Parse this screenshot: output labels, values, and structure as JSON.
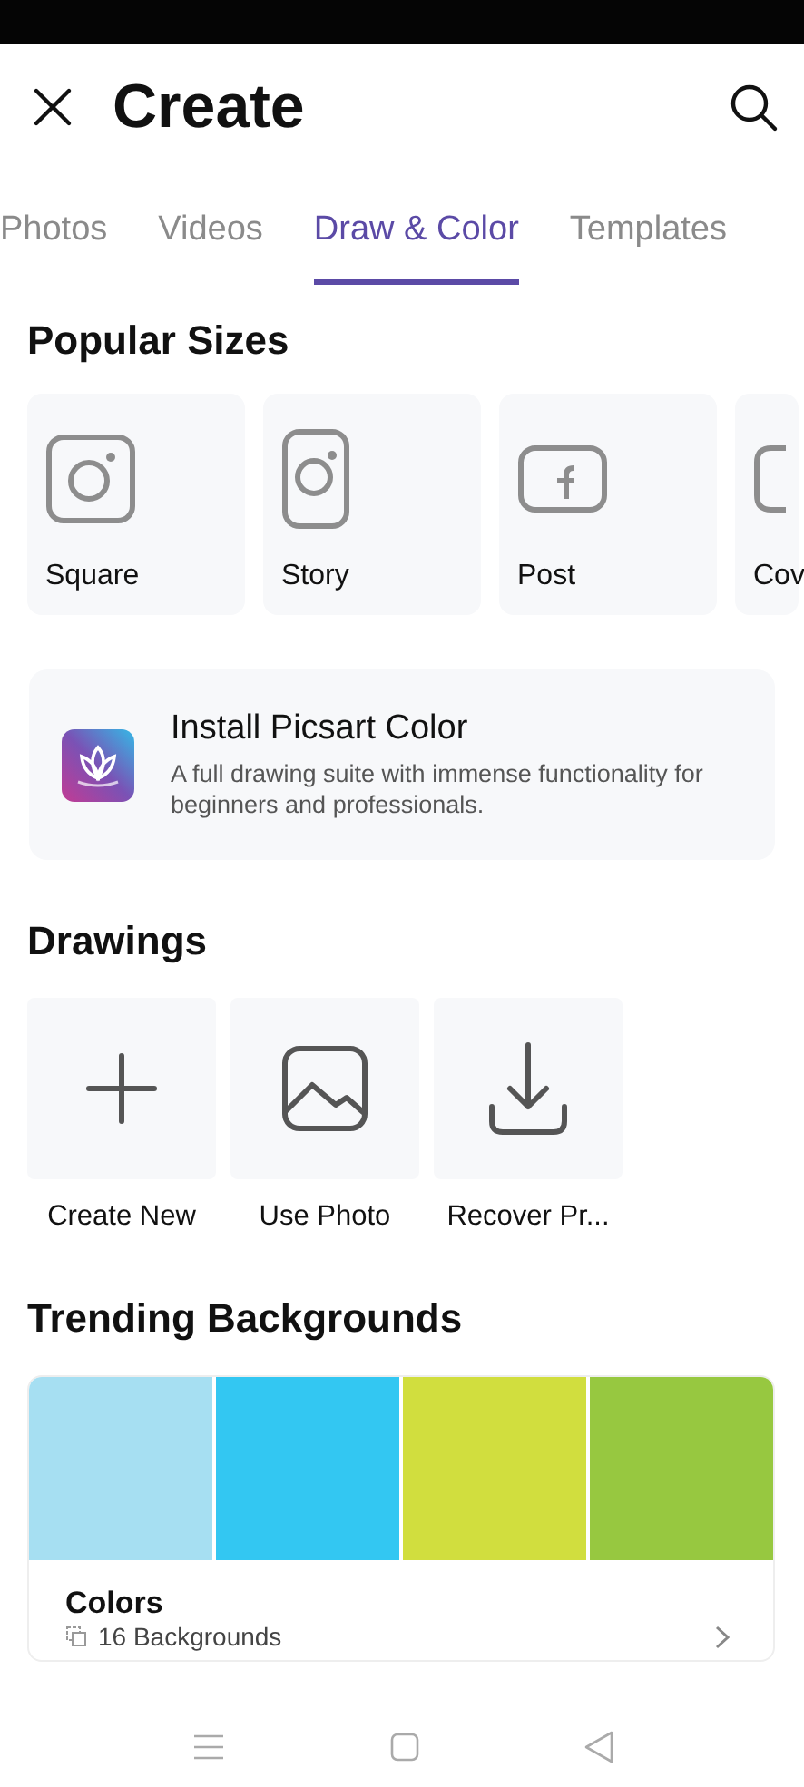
{
  "header": {
    "title": "Create"
  },
  "tabs": [
    {
      "label": "Photos",
      "selected": false
    },
    {
      "label": "Videos",
      "selected": false
    },
    {
      "label": "Draw & Color",
      "selected": true
    },
    {
      "label": "Templates",
      "selected": false
    }
  ],
  "popular_sizes": {
    "heading": "Popular Sizes",
    "items": [
      {
        "kind": "square",
        "label": "Square"
      },
      {
        "kind": "story",
        "label": "Story"
      },
      {
        "kind": "post",
        "label": "Post"
      },
      {
        "kind": "cover",
        "label": "Cov"
      }
    ]
  },
  "promo": {
    "title": "Install Picsart Color",
    "description": "A full drawing suite with immense functionality for beginners and professionals."
  },
  "drawings": {
    "heading": "Drawings",
    "items": [
      {
        "kind": "create",
        "label": "Create New"
      },
      {
        "kind": "photo",
        "label": "Use Photo"
      },
      {
        "kind": "recover",
        "label": "Recover Pr..."
      }
    ]
  },
  "trending": {
    "heading": "Trending Backgrounds",
    "cards": [
      {
        "title": "Colors",
        "count": "16 Backgrounds",
        "swatches": [
          {
            "color": "#a6dff2"
          },
          {
            "color": "#33c7f2"
          },
          {
            "color": "#d1de3e"
          },
          {
            "color": "#97c840"
          }
        ]
      }
    ]
  }
}
